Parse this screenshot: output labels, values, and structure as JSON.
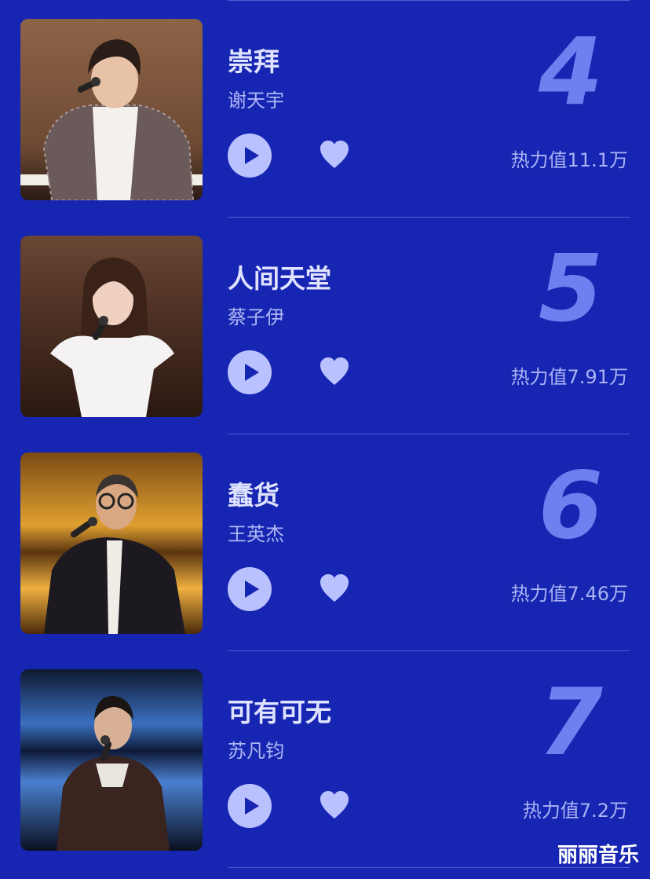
{
  "songs": [
    {
      "rank": "4",
      "title": "崇拜",
      "artist": "谢天宇",
      "heat": "热力值11.1万",
      "photo_bg": "#8a5a3a"
    },
    {
      "rank": "5",
      "title": "人间天堂",
      "artist": "蔡子伊",
      "heat": "热力值7.91万",
      "photo_bg": "#5a3a2a"
    },
    {
      "rank": "6",
      "title": "蠢货",
      "artist": "王英杰",
      "heat": "热力值7.46万",
      "photo_bg": "#c27a1a"
    },
    {
      "rank": "7",
      "title": "可有可无",
      "artist": "苏凡钧",
      "heat": "热力值7.2万",
      "photo_bg": "#1a2a55"
    }
  ],
  "icons": {
    "play": "play-icon",
    "like": "heart-icon"
  },
  "watermark": "丽丽音乐",
  "colors": {
    "background": "#1726b2",
    "rank_number": "#6f7ff0",
    "button_fill": "#b9c1ff"
  }
}
